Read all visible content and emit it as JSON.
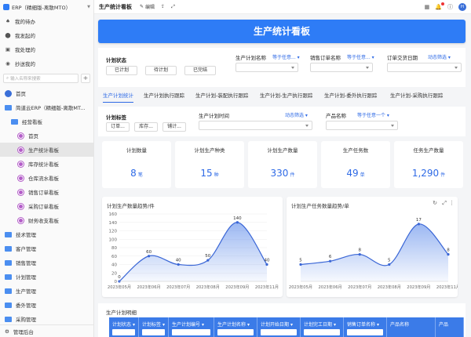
{
  "app": {
    "title": "ERP（精细版-离散MTO）"
  },
  "sidebar": {
    "top_nav": [
      {
        "label": "我的待办",
        "icon": "bell-icon"
      },
      {
        "label": "我发起的",
        "icon": "send-icon"
      },
      {
        "label": "我处理的",
        "icon": "check-icon"
      },
      {
        "label": "抄送我的",
        "icon": "cc-icon"
      }
    ],
    "search_placeholder": "输入名称来搜索",
    "tree": [
      {
        "label": "首页",
        "type": "home",
        "level": 0
      },
      {
        "label": "简道云ERP（精细版-离散MT...",
        "type": "folder",
        "level": 0
      },
      {
        "label": "经营看板",
        "type": "folder",
        "level": 1
      },
      {
        "label": "首页",
        "type": "dash",
        "level": 2
      },
      {
        "label": "生产统计看板",
        "type": "dash",
        "level": 2,
        "active": true
      },
      {
        "label": "库存统计看板",
        "type": "dash",
        "level": 2
      },
      {
        "label": "仓库流水看板",
        "type": "dash",
        "level": 2
      },
      {
        "label": "销售订单看板",
        "type": "dash",
        "level": 2
      },
      {
        "label": "采购订单看板",
        "type": "dash",
        "level": 2
      },
      {
        "label": "财务收支看板",
        "type": "dash",
        "level": 2
      },
      {
        "label": "技术管理",
        "type": "folder",
        "level": 0
      },
      {
        "label": "客户管理",
        "type": "folder",
        "level": 0
      },
      {
        "label": "销售管理",
        "type": "folder",
        "level": 0
      },
      {
        "label": "计划管理",
        "type": "folder",
        "level": 0
      },
      {
        "label": "生产管理",
        "type": "folder",
        "level": 0
      },
      {
        "label": "委外管理",
        "type": "folder",
        "level": 0
      },
      {
        "label": "采购管理",
        "type": "folder",
        "level": 0
      }
    ],
    "footer": "管理后台"
  },
  "topbar": {
    "title": "生产统计看板",
    "edit": "编辑",
    "avatar_letter": "H"
  },
  "banner": "生产统计看板",
  "filters1": {
    "status_label": "计划状态",
    "status_chips": [
      "已计划",
      "待计划",
      "已完结"
    ],
    "plan_name_label": "生产计划名称",
    "plan_name_value": "等于任意...",
    "order_name_label": "销售订单名称",
    "order_name_value": "等于任意...",
    "delivery_label": "订单交货日期",
    "delivery_value": "动态筛选"
  },
  "tabs": [
    "生产计划统计",
    "生产计划执行跟踪",
    "生产计划-装配执行跟踪",
    "生产计划-生产执行跟踪",
    "生产计划-委外执行跟踪",
    "生产计划-采购执行跟踪"
  ],
  "filters2": {
    "tag_label": "计划标签",
    "tag_chips": [
      "订单...",
      "库存...",
      "铺计..."
    ],
    "time_label": "生产计划时间",
    "time_value": "动态筛选",
    "product_label": "产品名称",
    "product_value": "等于任意一个"
  },
  "cards": [
    {
      "title": "计划数量",
      "value": "8",
      "unit": "笔"
    },
    {
      "title": "计划生产种类",
      "value": "15",
      "unit": "种"
    },
    {
      "title": "计划生产数量",
      "value": "330",
      "unit": "件"
    },
    {
      "title": "生产任务数",
      "value": "49",
      "unit": "单"
    },
    {
      "title": "任务生产数量",
      "value": "1,290",
      "unit": "件"
    }
  ],
  "charts": {
    "left_title": "计划生产数量趋势/件",
    "right_title": "计划生产任务数量趋势/单"
  },
  "chart_data": [
    {
      "type": "area",
      "title": "计划生产数量趋势/件",
      "categories": [
        "2023年05月",
        "2023年06月",
        "2023年07月",
        "2023年08月",
        "2023年09月",
        "2023年11月"
      ],
      "values": [
        0,
        60,
        40,
        50,
        140,
        40
      ],
      "yticks": [
        0,
        20,
        40,
        60,
        80,
        100,
        120,
        140,
        160
      ],
      "ylim": [
        0,
        160
      ]
    },
    {
      "type": "area",
      "title": "计划生产任务数量趋势/单",
      "categories": [
        "2023年05月",
        "2023年06月",
        "2023年07月",
        "2023年08月",
        "2023年09月",
        "2023年11月"
      ],
      "values": [
        5,
        6,
        8,
        5,
        17,
        8
      ],
      "ylim": [
        0,
        20
      ]
    }
  ],
  "table": {
    "title": "生产计划明细",
    "columns": [
      "计划状态",
      "计划标签",
      "生产计划编号",
      "生产计划名称",
      "计划开始日期",
      "计划完工日期",
      "销售订单名称",
      "产品名称",
      "产品"
    ]
  }
}
